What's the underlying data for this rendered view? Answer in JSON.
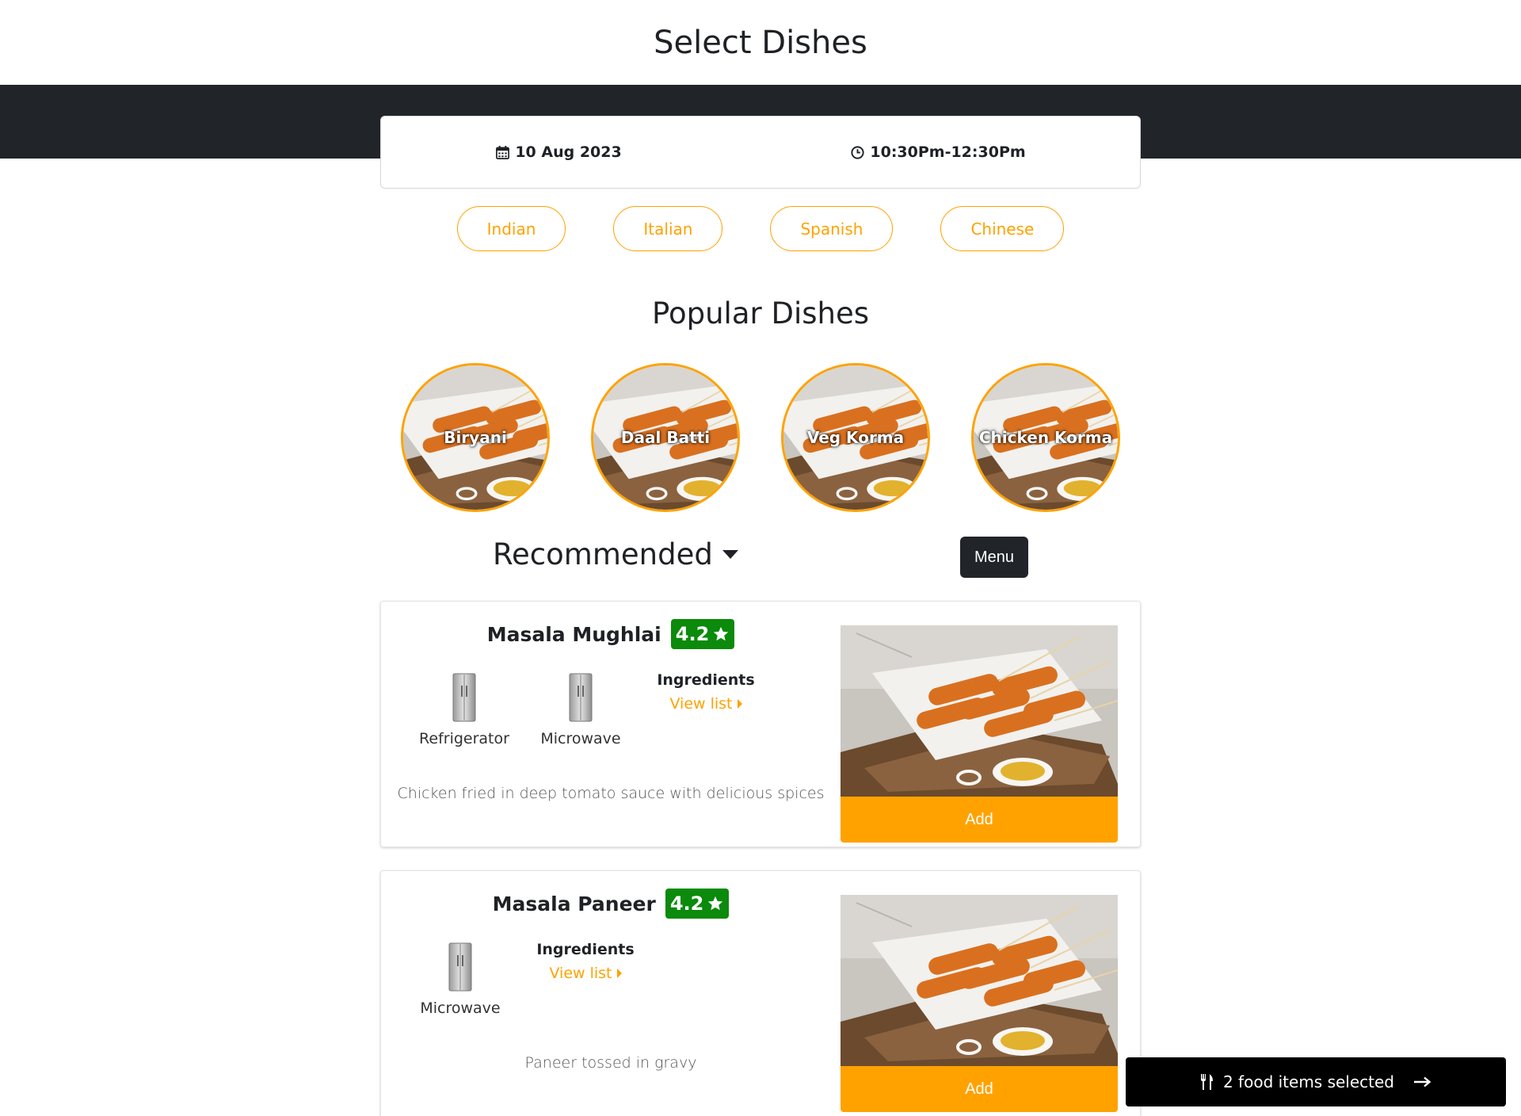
{
  "header": {
    "title": "Select Dishes"
  },
  "schedule": {
    "date": "10 Aug 2023",
    "time": "10:30Pm-12:30Pm"
  },
  "cuisines": [
    "Indian",
    "Italian",
    "Spanish",
    "Chinese"
  ],
  "popular": {
    "title": "Popular Dishes",
    "dishes": [
      "Biryani",
      "Daal Batti",
      "Veg Korma",
      "Chicken Korma"
    ]
  },
  "recommended": {
    "label": "Recommended",
    "menu_button": "Menu"
  },
  "dishes": [
    {
      "name": "Masala Mughlai",
      "rating": "4.2",
      "appliances": [
        "Refrigerator",
        "Microwave"
      ],
      "ingredients_label": "Ingredients",
      "view_list": "View list",
      "description": "Chicken fried in deep tomato sauce with delicious spices",
      "add_label": "Add"
    },
    {
      "name": "Masala Paneer",
      "rating": "4.2",
      "appliances": [
        "Microwave"
      ],
      "ingredients_label": "Ingredients",
      "view_list": "View list",
      "description": "Paneer tossed in gravy",
      "add_label": "Add"
    }
  ],
  "cart": {
    "label": "2 food items selected"
  },
  "colors": {
    "accent": "#ffa200",
    "dark": "#212529",
    "rating": "#0b8a0b"
  },
  "icons": [
    "calendar-icon",
    "clock-icon",
    "star-icon",
    "caret-down-icon",
    "caret-right-icon",
    "fork-knife-icon",
    "arrow-right-icon",
    "fridge-icon"
  ]
}
